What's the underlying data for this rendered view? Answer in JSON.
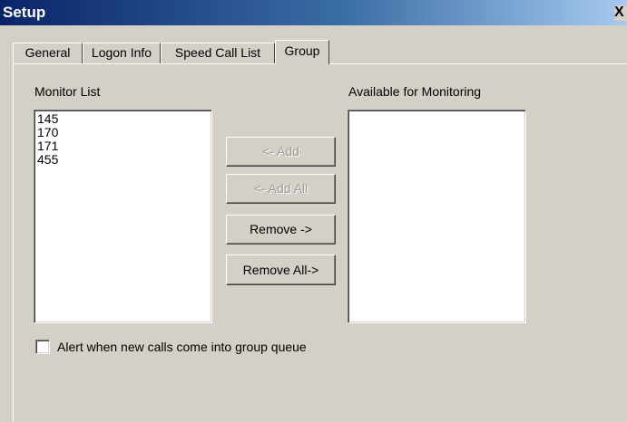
{
  "window": {
    "title": "Setup",
    "close_glyph": "✕"
  },
  "tabs": [
    {
      "label": "General"
    },
    {
      "label": "Logon Info"
    },
    {
      "label": "Speed Call List"
    },
    {
      "label": "Group",
      "active": true
    }
  ],
  "monitor_list": {
    "label": "Monitor List",
    "items": [
      "145",
      "170",
      "171",
      "455"
    ]
  },
  "available_list": {
    "label": "Available for Monitoring",
    "items": []
  },
  "buttons": {
    "add": "<- Add",
    "add_all": "<- Add All",
    "remove": "Remove ->",
    "remove_all": "Remove All->"
  },
  "alert_checkbox": {
    "label": "Alert when new calls come into group queue",
    "checked": false
  }
}
